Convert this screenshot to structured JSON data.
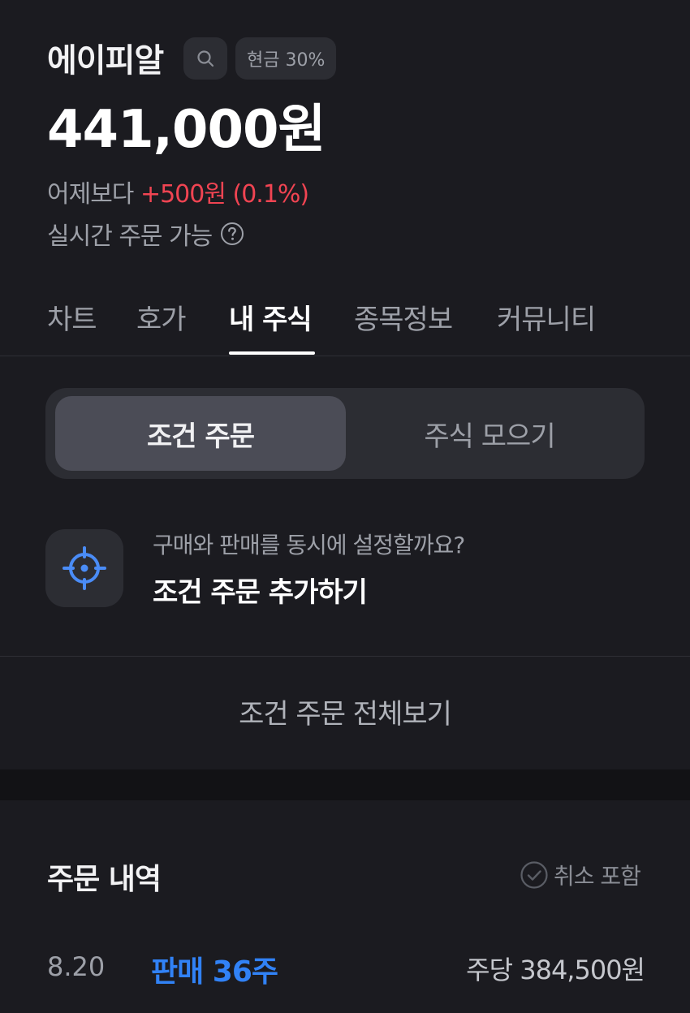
{
  "header": {
    "stock_name": "에이피알",
    "cash_badge": "현금 30%",
    "price": "441,000원",
    "change_prefix": "어제보다",
    "change_value": "+500원 (0.1%)",
    "realtime_label": "실시간 주문 가능"
  },
  "tabs": [
    {
      "label": "차트"
    },
    {
      "label": "호가"
    },
    {
      "label": "내 주식"
    },
    {
      "label": "종목정보"
    },
    {
      "label": "커뮤니티"
    }
  ],
  "active_tab": "내 주식",
  "segment": {
    "active_label": "조건 주문",
    "inactive_label": "주식 모으기"
  },
  "condition": {
    "question": "구매와 판매를 동시에 설정할까요?",
    "add_label": "조건 주문 추가하기",
    "view_all": "조건 주문 전체보기"
  },
  "history": {
    "title": "주문 내역",
    "include_cancel": "취소 포함",
    "orders": [
      {
        "date": "8.20",
        "type": "판매 36주",
        "price": "주당 384,500원"
      }
    ]
  },
  "colors": {
    "background": "#1b1b20",
    "up_red": "#f04452",
    "sell_blue": "#3182f6",
    "target_icon_blue": "#4a8cf7"
  },
  "icons": [
    "search-icon",
    "help-icon",
    "target-icon",
    "check-circle-icon"
  ]
}
